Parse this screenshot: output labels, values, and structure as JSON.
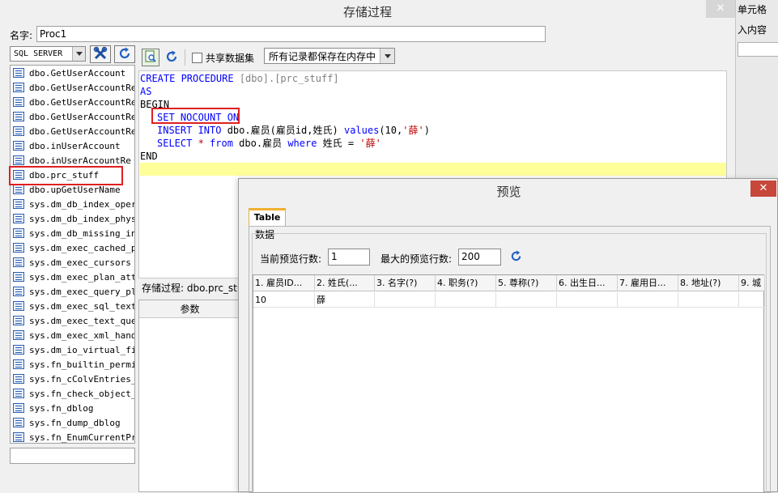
{
  "main": {
    "title": "存储过程",
    "close_glyph": "✕",
    "name_label": "名字:",
    "name_value": "Proc1",
    "db_select": "SQL SERVER",
    "share_label": "共享数据集",
    "memory_select": "所有记录都保存在内存中",
    "proc_label": "存储过程: dbo.prc_stu",
    "params_header": "参数"
  },
  "right_strip": {
    "cell_label": "单元格",
    "content_label": "入内容"
  },
  "proc_list": [
    "dbo.GetUserAccount",
    "dbo.GetUserAccountRe",
    "dbo.GetUserAccountRe",
    "dbo.GetUserAccountRe",
    "dbo.GetUserAccountRe",
    "dbo.inUserAccount",
    "dbo.inUserAccountRe",
    "dbo.prc_stuff",
    "dbo.upGetUserName",
    "sys.dm_db_index_opera",
    "sys.dm_db_index_phys",
    "sys.dm_db_missing_in",
    "sys.dm_exec_cached_pl",
    "sys.dm_exec_cursors",
    "sys.dm_exec_plan_attr",
    "sys.dm_exec_query_pla",
    "sys.dm_exec_sql_text",
    "sys.dm_exec_text_quer",
    "sys.dm_exec_xml_handl",
    "sys.dm_io_virtual_fil",
    "sys.fn_builtin_permis",
    "sys.fn_cColvEntries_8",
    "sys.fn_check_object_s",
    "sys.fn_dblog",
    "sys.fn_dump_dblog",
    "sys.fn_EnumCurrentPri"
  ],
  "code": {
    "l1a": "CREATE PROCEDURE ",
    "l1b": "[dbo]",
    "l1c": ".",
    "l1d": "[prc_stuff]",
    "l2": "AS",
    "l3": "BEGIN",
    "l4": "SET NOCOUNT ON",
    "l5a": "INSERT INTO",
    "l5b": " dbo.雇员(雇员id,姓氏) ",
    "l5c": "values",
    "l5d": "(10,",
    "l5e": "'薛'",
    "l5f": ")",
    "l6a": "SELECT",
    "l6b": " * ",
    "l6c": "from",
    "l6d": " dbo.雇员 ",
    "l6e": "where",
    "l6f": " 姓氏 = ",
    "l6g": "'薛'",
    "l7": "END"
  },
  "preview": {
    "title": "预览",
    "close_glyph": "✕",
    "tab": "Table",
    "group": "数据",
    "current_rows_label": "当前预览行数:",
    "current_rows_value": "1",
    "max_rows_label": "最大的预览行数:",
    "max_rows_value": "200",
    "columns": [
      "1. 雇员ID...",
      "2. 姓氏(...",
      "3. 名字(?)",
      "4. 职务(?)",
      "5. 尊称(?)",
      "6. 出生日...",
      "7. 雇用日...",
      "8. 地址(?)",
      "9. 城"
    ],
    "rows": [
      [
        "10",
        "薛",
        "",
        "",
        "",
        "",
        "",
        "",
        ""
      ]
    ]
  }
}
